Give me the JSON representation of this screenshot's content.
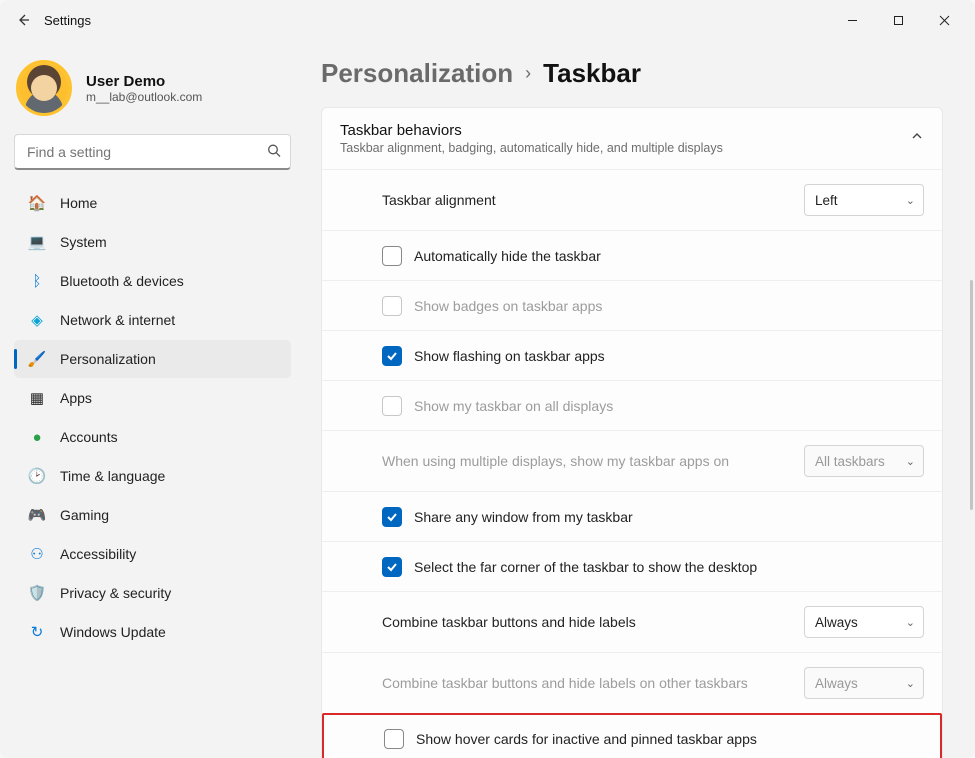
{
  "window": {
    "title": "Settings"
  },
  "user": {
    "name": "User Demo",
    "email": "m__lab@outlook.com"
  },
  "search": {
    "placeholder": "Find a setting"
  },
  "sidebar": {
    "items": [
      {
        "label": "Home"
      },
      {
        "label": "System"
      },
      {
        "label": "Bluetooth & devices"
      },
      {
        "label": "Network & internet"
      },
      {
        "label": "Personalization"
      },
      {
        "label": "Apps"
      },
      {
        "label": "Accounts"
      },
      {
        "label": "Time & language"
      },
      {
        "label": "Gaming"
      },
      {
        "label": "Accessibility"
      },
      {
        "label": "Privacy & security"
      },
      {
        "label": "Windows Update"
      }
    ]
  },
  "breadcrumb": {
    "parent": "Personalization",
    "current": "Taskbar"
  },
  "card": {
    "title": "Taskbar behaviors",
    "subtitle": "Taskbar alignment, badging, automatically hide, and multiple displays"
  },
  "rows": {
    "alignment": {
      "label": "Taskbar alignment",
      "value": "Left"
    },
    "autohide": {
      "label": "Automatically hide the taskbar"
    },
    "badges": {
      "label": "Show badges on taskbar apps"
    },
    "flashing": {
      "label": "Show flashing on taskbar apps"
    },
    "alldisplays": {
      "label": "Show my taskbar on all displays"
    },
    "multidisp": {
      "label": "When using multiple displays, show my taskbar apps on",
      "value": "All taskbars"
    },
    "sharewin": {
      "label": "Share any window from my taskbar"
    },
    "farcorner": {
      "label": "Select the far corner of the taskbar to show the desktop"
    },
    "combine": {
      "label": "Combine taskbar buttons and hide labels",
      "value": "Always"
    },
    "combineother": {
      "label": "Combine taskbar buttons and hide labels on other taskbars",
      "value": "Always"
    },
    "hovercards": {
      "label": "Show hover cards for inactive and pinned taskbar apps"
    }
  }
}
